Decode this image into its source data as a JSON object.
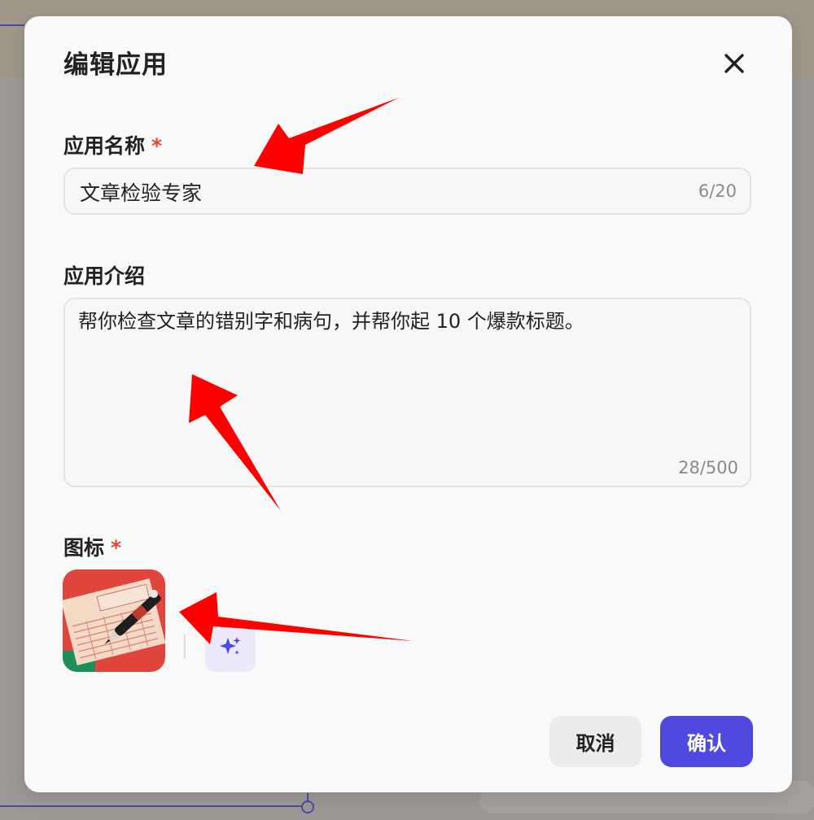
{
  "dialog": {
    "title": "编辑应用",
    "close_icon": "close-icon"
  },
  "fields": {
    "name": {
      "label": "应用名称",
      "required_mark": "*",
      "value": "文章检验专家",
      "counter": "6/20"
    },
    "description": {
      "label": "应用介绍",
      "value": "帮你检查文章的错别字和病句，并帮你起 10 个爆款标题。",
      "counter": "28/500"
    },
    "icon": {
      "label": "图标",
      "required_mark": "*",
      "preview_icon": "article-pen-icon",
      "ai_generate_icon": "sparkle-icon"
    }
  },
  "footer": {
    "cancel_label": "取消",
    "confirm_label": "确认"
  },
  "colors": {
    "accent": "#5049e0",
    "required": "#e5432f",
    "annotation_arrow": "#ff0000"
  }
}
